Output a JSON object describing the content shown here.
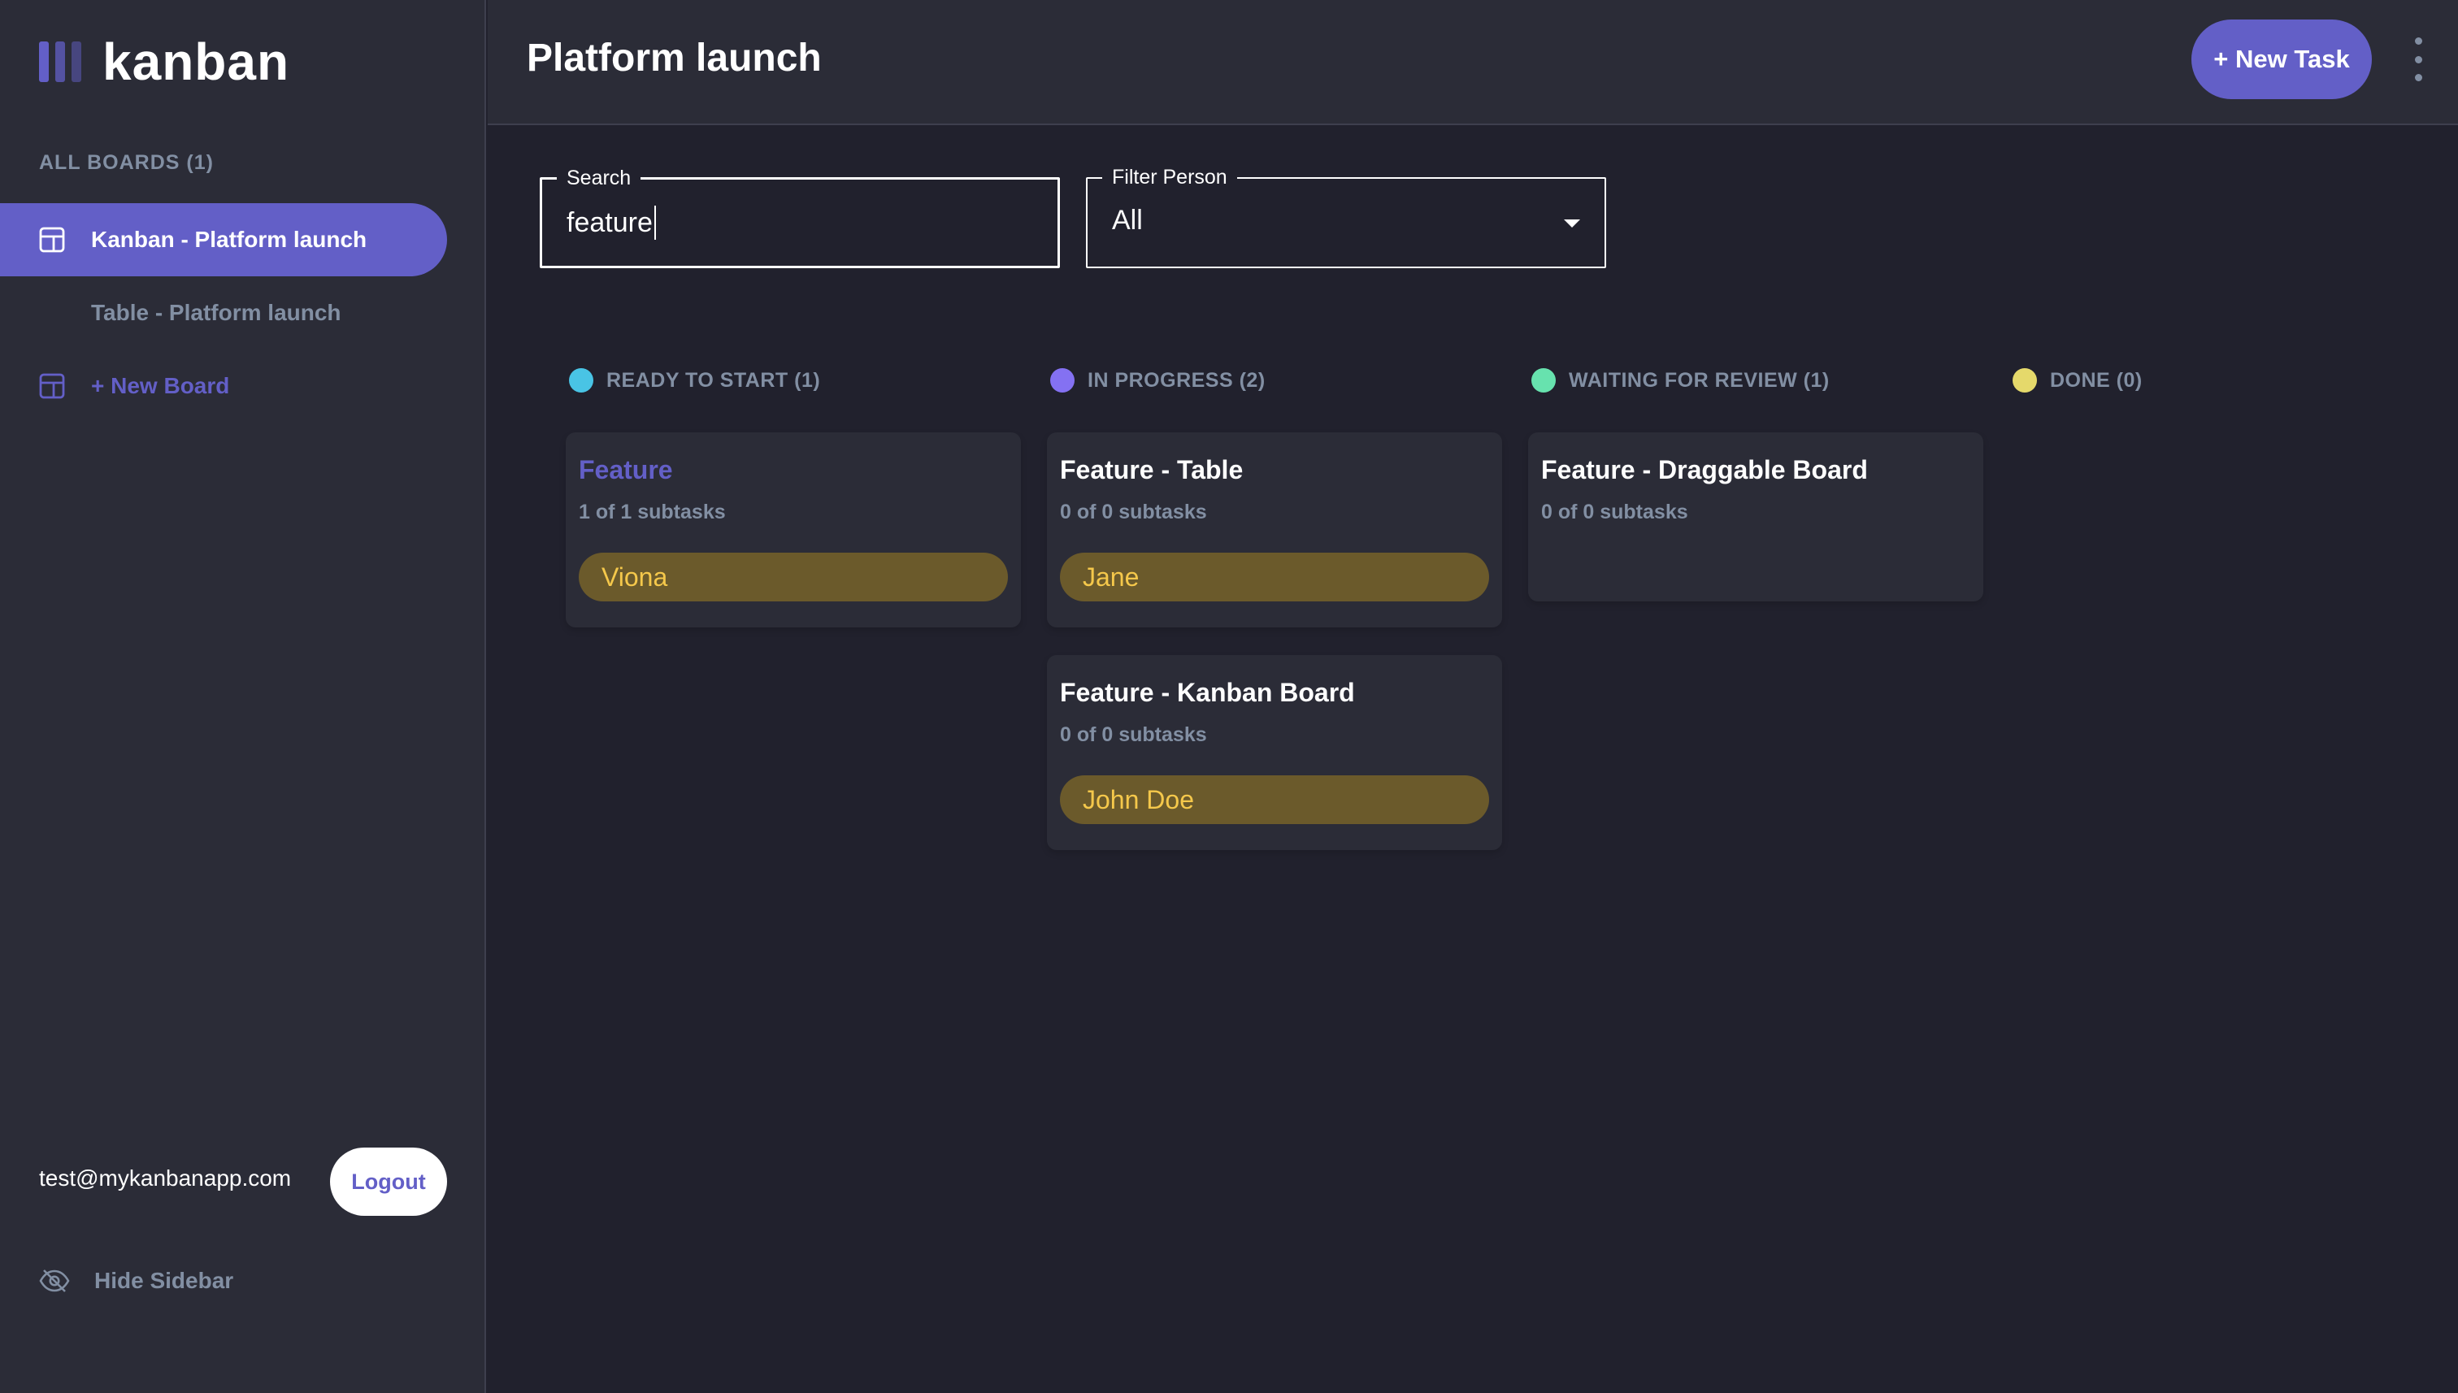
{
  "app": {
    "brand": "kanban"
  },
  "sidebar": {
    "heading": "ALL BOARDS (1)",
    "items": [
      {
        "label": "Kanban - Platform launch",
        "active": true
      },
      {
        "label": "Table - Platform launch",
        "active": false
      },
      {
        "label": "+ New Board",
        "active": false
      }
    ],
    "user_email": "test@mykanbanapp.com",
    "logout_label": "Logout",
    "hide_label": "Hide Sidebar"
  },
  "header": {
    "title": "Platform launch",
    "new_task_label": "+ New Task"
  },
  "filters": {
    "search_label": "Search",
    "search_value": "feature",
    "person_label": "Filter Person",
    "person_value": "All"
  },
  "columns": [
    {
      "label": "READY TO START (1)",
      "color": "#49c4e5"
    },
    {
      "label": "IN PROGRESS (2)",
      "color": "#8471f2"
    },
    {
      "label": "WAITING FOR REVIEW (1)",
      "color": "#67e2ae"
    },
    {
      "label": "DONE (0)",
      "color": "#e5d96b"
    }
  ],
  "cards": [
    {
      "title": "Feature",
      "subtasks": "1 of 1 subtasks",
      "assignee": "Viona"
    },
    {
      "title": "Feature - Table",
      "subtasks": "0 of 0 subtasks",
      "assignee": "Jane"
    },
    {
      "title": "Feature - Kanban Board",
      "subtasks": "0 of 0 subtasks",
      "assignee": "John Doe"
    },
    {
      "title": "Feature - Draggable Board",
      "subtasks": "0 of 0 subtasks",
      "assignee": ""
    }
  ],
  "colors": {
    "accent": "#635fc7",
    "background": "#21212d",
    "surface": "#2b2c37",
    "assignee_bg": "#6b5a2b",
    "assignee_text": "#f5c84b"
  }
}
